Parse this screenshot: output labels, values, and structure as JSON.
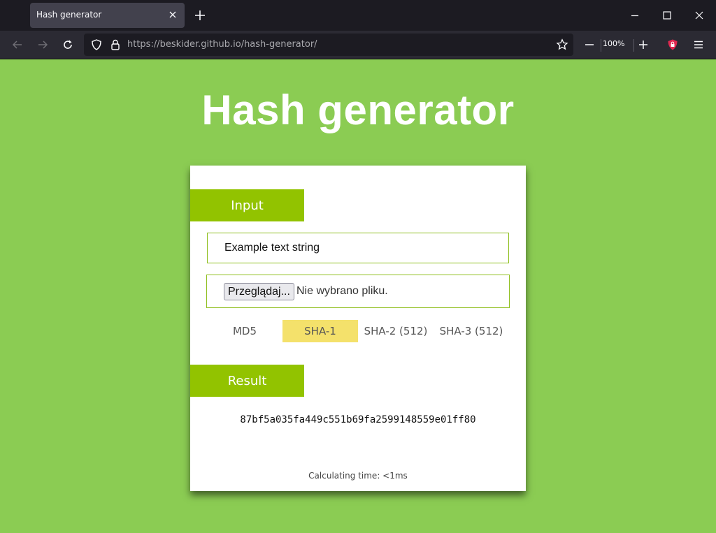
{
  "browser": {
    "tab_title": "Hash generator",
    "url_host": "https://beskider.github.io",
    "url_path": "/hash-generator/",
    "zoom": "100%",
    "colors": {
      "chrome_dark": "#1c1b22",
      "toolbar": "#2b2a33",
      "tab_active": "#42414d"
    }
  },
  "page": {
    "title": "Hash generator",
    "background_color": "#8bcc53",
    "accent_color": "#92c300",
    "selected_color": "#f4e16b"
  },
  "input_section": {
    "heading": "Input",
    "text_value": "Example text string",
    "file_button": "Przeglądaj...",
    "file_status": "Nie wybrano pliku."
  },
  "algorithms": [
    {
      "label": "MD5",
      "selected": false
    },
    {
      "label": "SHA-1",
      "selected": true
    },
    {
      "label": "SHA-2 (512)",
      "selected": false
    },
    {
      "label": "SHA-3 (512)",
      "selected": false
    }
  ],
  "result_section": {
    "heading": "Result",
    "hash": "87bf5a035fa449c551b69fa2599148559e01ff80",
    "calc_time": "Calculating time: <1ms"
  }
}
